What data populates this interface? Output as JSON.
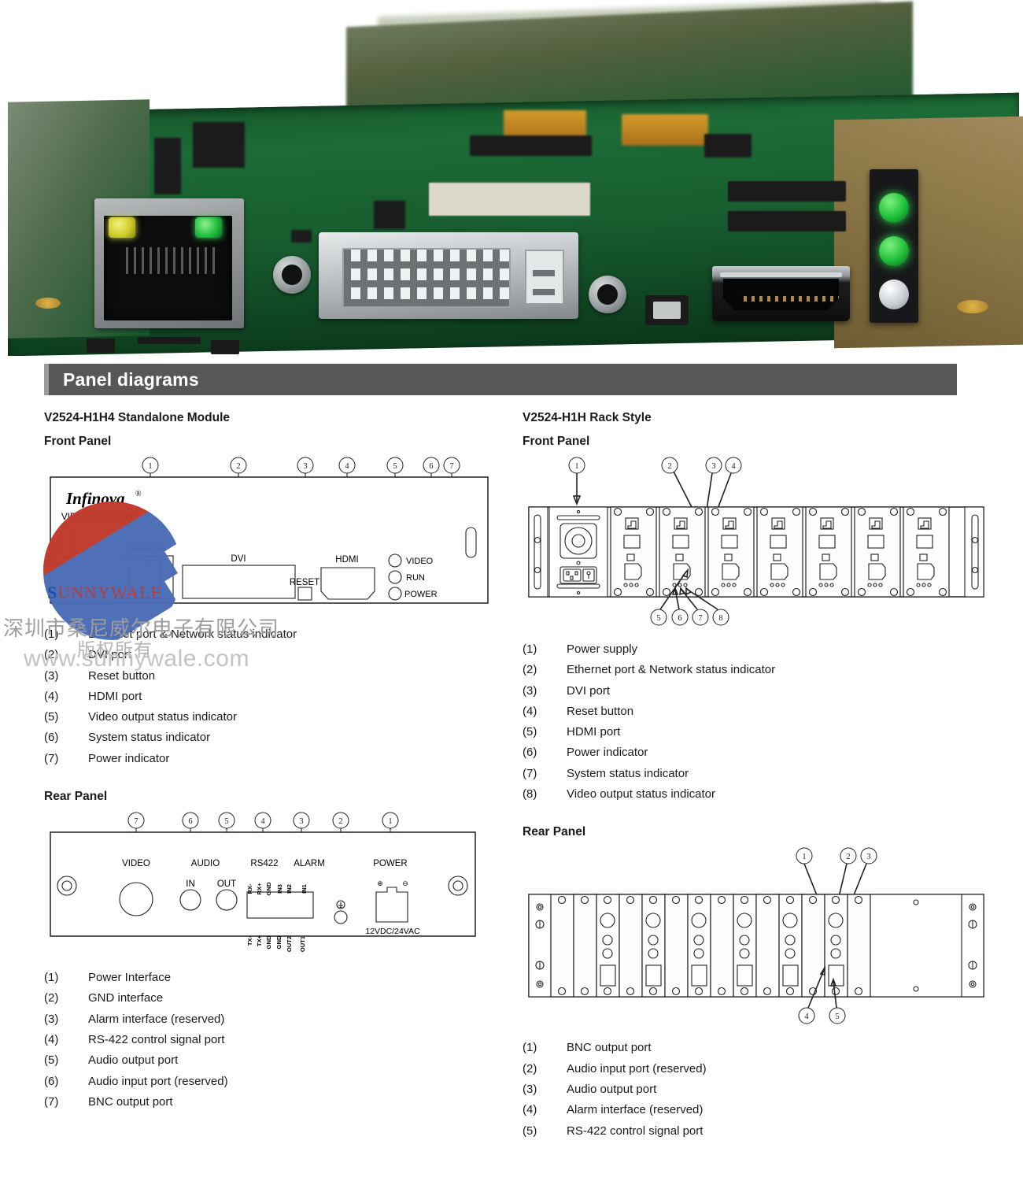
{
  "photo": {
    "alt": "Close-up photo of V2524 decoder PCB showing RJ45 ethernet jack, DVI connector, reset tact switch, HDMI port and status LED bar",
    "components": [
      {
        "name": "ethernet-rj45-jack",
        "leds": [
          "amber",
          "green"
        ]
      },
      {
        "name": "dvi-connector"
      },
      {
        "name": "reset-tact-switch"
      },
      {
        "name": "hdmi-connector"
      },
      {
        "name": "status-led-bar",
        "leds": [
          "green",
          "green",
          "clear"
        ]
      }
    ]
  },
  "section": {
    "title": "Panel diagrams"
  },
  "left_column": {
    "model_title": "V2524-H1H4 Standalone Module",
    "front": {
      "heading": "Front Panel",
      "diagram": {
        "brand": "Infinova",
        "brand_mark": "®",
        "product_label": "VIDEO DECODER",
        "port_labels": [
          "ETHERNET",
          "DVI",
          "RESET",
          "HDMI"
        ],
        "led_labels": [
          "VIDEO",
          "RUN",
          "POWER"
        ],
        "callouts": [
          "1",
          "2",
          "3",
          "4",
          "5",
          "6",
          "7"
        ]
      },
      "legend": [
        {
          "num": "(1)",
          "text": "Ethernet port & Network status indicator"
        },
        {
          "num": "(2)",
          "text": "DVI port"
        },
        {
          "num": "(3)",
          "text": "Reset button"
        },
        {
          "num": "(4)",
          "text": "HDMI port"
        },
        {
          "num": "(5)",
          "text": "Video output status indicator"
        },
        {
          "num": "(6)",
          "text": "System status indicator"
        },
        {
          "num": "(7)",
          "text": "Power indicator"
        }
      ]
    },
    "rear": {
      "heading": "Rear Panel",
      "diagram": {
        "group_labels": [
          "VIDEO",
          "AUDIO",
          "RS422",
          "ALARM",
          "POWER"
        ],
        "audio_labels": [
          "IN",
          "OUT"
        ],
        "terminal_top": [
          "RX-",
          "RX+",
          "GND",
          "IN3",
          "IN2",
          "IN1"
        ],
        "terminal_bottom": [
          "TX-",
          "TX+",
          "GND",
          "GND",
          "OUT2",
          "OUT1"
        ],
        "power_rating": "12VDC/24VAC",
        "callouts": [
          "7",
          "6",
          "5",
          "4",
          "3",
          "2",
          "1"
        ]
      },
      "legend": [
        {
          "num": "(1)",
          "text": "Power Interface"
        },
        {
          "num": "(2)",
          "text": "GND interface"
        },
        {
          "num": "(3)",
          "text": "Alarm interface (reserved)"
        },
        {
          "num": "(4)",
          "text": "RS-422 control signal port"
        },
        {
          "num": "(5)",
          "text": "Audio output port"
        },
        {
          "num": "(6)",
          "text": "Audio input port (reserved)"
        },
        {
          "num": "(7)",
          "text": "BNC output port"
        }
      ]
    }
  },
  "right_column": {
    "model_title": "V2524-H1H Rack Style",
    "front": {
      "heading": "Front Panel",
      "diagram": {
        "callouts": [
          "1",
          "2",
          "3",
          "4",
          "5",
          "6",
          "7",
          "8"
        ],
        "slot_count": 7
      },
      "legend": [
        {
          "num": "(1)",
          "text": "Power supply"
        },
        {
          "num": "(2)",
          "text": "Ethernet port & Network status indicator"
        },
        {
          "num": "(3)",
          "text": "DVI port"
        },
        {
          "num": "(4)",
          "text": "Reset button"
        },
        {
          "num": "(5)",
          "text": "HDMI port"
        },
        {
          "num": "(6)",
          "text": "Power indicator"
        },
        {
          "num": "(7)",
          "text": "System status indicator"
        },
        {
          "num": "(8)",
          "text": "Video output status indicator"
        }
      ]
    },
    "rear": {
      "heading": "Rear Panel",
      "diagram": {
        "callouts": [
          "1",
          "2",
          "3",
          "4",
          "5"
        ],
        "slot_count": 7
      },
      "legend": [
        {
          "num": "(1)",
          "text": "BNC output port"
        },
        {
          "num": "(2)",
          "text": "Audio input port (reserved)"
        },
        {
          "num": "(3)",
          "text": "Audio output port"
        },
        {
          "num": "(4)",
          "text": "Alarm interface (reserved)"
        },
        {
          "num": "(5)",
          "text": "RS-422 control signal port"
        }
      ]
    }
  },
  "watermark": {
    "brand": "SUNNYWALE",
    "company_cn": "深圳市桑尼威尔电子有限公司",
    "rights_cn": "版权所有",
    "url": "www.sunnywale.com"
  }
}
